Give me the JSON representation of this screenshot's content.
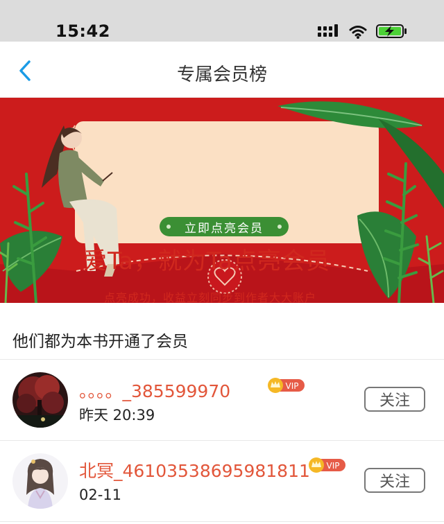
{
  "status_bar": {
    "time": "15:42",
    "icons": [
      "signal-icon",
      "wifi-icon",
      "battery-charging-icon"
    ]
  },
  "nav": {
    "title": "专属会员榜",
    "back_icon": "chevron-left-icon"
  },
  "banner": {
    "headline": "爱Ta，就为Ta点亮会员",
    "subtext": "点亮成功，收益立刻同步到作者大大账户",
    "cta_label": "立即点亮会员",
    "colors": {
      "background": "#cc1c1c",
      "card": "#fbe0c4",
      "cta": "#3b8f34",
      "text": "#d0281e"
    }
  },
  "section": {
    "title": "他们都为本书开通了会员"
  },
  "members": [
    {
      "name": "。。。。_385599970",
      "badge": "VIP",
      "time": "昨天 20:39",
      "follow_label": "关注"
    },
    {
      "name": "北冥_46103538695981811",
      "badge": "VIP",
      "time": "02-11",
      "follow_label": "关注"
    }
  ]
}
